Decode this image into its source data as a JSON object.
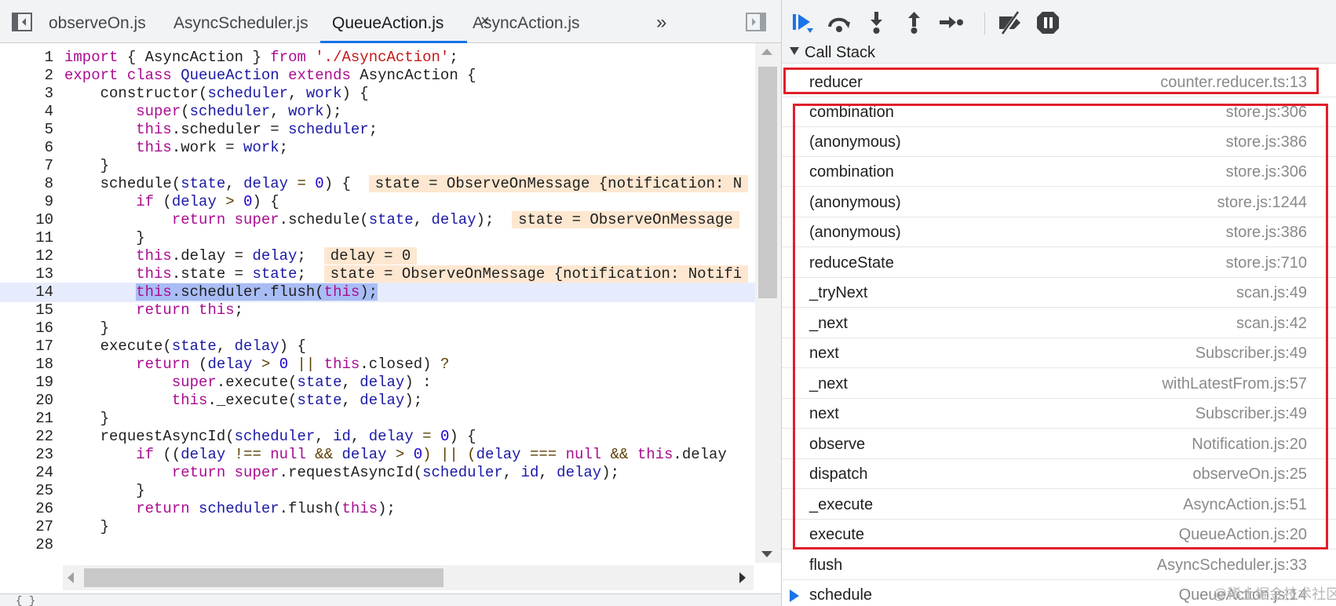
{
  "editor": {
    "tabs": [
      {
        "label": "observeOn.js"
      },
      {
        "label": "AsyncScheduler.js"
      },
      {
        "label": "QueueAction.js",
        "active": true,
        "close": "×"
      },
      {
        "label": "AsyncAction.js"
      }
    ],
    "overflow_icon": "»",
    "format_icon": "{ }",
    "execution_line": 14
  },
  "code_lines": [
    {
      "n": "1"
    },
    {
      "n": "2"
    },
    {
      "n": "3"
    },
    {
      "n": "4"
    },
    {
      "n": "5"
    },
    {
      "n": "6"
    },
    {
      "n": "7"
    },
    {
      "n": "8"
    },
    {
      "n": "9"
    },
    {
      "n": "10"
    },
    {
      "n": "11"
    },
    {
      "n": "12"
    },
    {
      "n": "13"
    },
    {
      "n": "14"
    },
    {
      "n": "15"
    },
    {
      "n": "16"
    },
    {
      "n": "17"
    },
    {
      "n": "18"
    },
    {
      "n": "19"
    },
    {
      "n": "20"
    },
    {
      "n": "21"
    },
    {
      "n": "22"
    },
    {
      "n": "23"
    },
    {
      "n": "24"
    },
    {
      "n": "25"
    },
    {
      "n": "26"
    },
    {
      "n": "27"
    },
    {
      "n": "28"
    }
  ],
  "code_text": {
    "l1": {
      "a": "import",
      "b": " { AsyncAction } ",
      "c": "from",
      "d": " ",
      "e": "'./AsyncAction'",
      "f": ";"
    },
    "l2": {
      "a": "export",
      "b": " ",
      "c": "class",
      "d": " ",
      "e": "QueueAction",
      "f": " ",
      "g": "extends",
      "h": " AsyncAction {"
    },
    "l3": {
      "a": "    constructor(",
      "b": "scheduler",
      "c": ", ",
      "d": "work",
      "e": ") {"
    },
    "l4": {
      "a": "        ",
      "b": "super",
      "c": "(",
      "d": "scheduler",
      "e": ", ",
      "f": "work",
      "g": ");"
    },
    "l5": {
      "a": "        ",
      "b": "this",
      "c": ".scheduler = ",
      "d": "scheduler",
      "e": ";"
    },
    "l6": {
      "a": "        ",
      "b": "this",
      "c": ".work = ",
      "d": "work",
      "e": ";"
    },
    "l7": {
      "a": "    }"
    },
    "l8": {
      "a": "    schedule(",
      "b": "state",
      "c": ", ",
      "d": "delay",
      "e": " = ",
      "f": "0",
      "g": ") {  ",
      "h": "state = ObserveOnMessage {notification: N"
    },
    "l9": {
      "a": "        ",
      "b": "if",
      "c": " (",
      "d": "delay",
      "e": " > ",
      "f": "0",
      "g": ") {"
    },
    "l10": {
      "a": "            ",
      "b": "return",
      "c": " ",
      "d": "super",
      "e": ".schedule(",
      "f": "state",
      "g": ", ",
      "h": "delay",
      "i": ");  ",
      "j": "state = ObserveOnMessage"
    },
    "l11": {
      "a": "        }"
    },
    "l12": {
      "a": "        ",
      "b": "this",
      "c": ".delay = ",
      "d": "delay",
      "e": ";  ",
      "f": "delay = 0"
    },
    "l13": {
      "a": "        ",
      "b": "this",
      "c": ".state = ",
      "d": "state",
      "e": ";  ",
      "f": "state = ObserveOnMessage {notification: Notifi"
    },
    "l14": {
      "a": "        ",
      "b": "this",
      "c": ".scheduler.flush(",
      "d": "this",
      "e": ");"
    },
    "l15": {
      "a": "        ",
      "b": "return",
      "c": " ",
      "d": "this",
      "e": ";"
    },
    "l16": {
      "a": "    }"
    },
    "l17": {
      "a": "    execute(",
      "b": "state",
      "c": ", ",
      "d": "delay",
      "e": ") {"
    },
    "l18": {
      "a": "        ",
      "b": "return",
      "c": " (",
      "d": "delay",
      "e": " > ",
      "f": "0",
      "g": " || ",
      "h": "this",
      "i": ".closed) ",
      "j": "?"
    },
    "l19": {
      "a": "            ",
      "b": "super",
      "c": ".execute(",
      "d": "state",
      "e": ", ",
      "f": "delay",
      "g": ") :"
    },
    "l20": {
      "a": "            ",
      "b": "this",
      "c": "._execute(",
      "d": "state",
      "e": ", ",
      "f": "delay",
      "g": ");"
    },
    "l21": {
      "a": "    }"
    },
    "l22": {
      "a": "    requestAsyncId(",
      "b": "scheduler",
      "c": ", ",
      "d": "id",
      "e": ", ",
      "f": "delay",
      "g": " = ",
      "h": "0",
      "i": ") {"
    },
    "l23": {
      "a": "        ",
      "b": "if",
      "c": " ((",
      "d": "delay",
      "e": " !== ",
      "f": "null",
      "g": " && ",
      "h": "delay",
      "i": " > ",
      "j": "0",
      "k": ") || (",
      "l": "delay",
      "m": " === ",
      "n": "null",
      "o": " && ",
      "p": "this",
      "q": ".delay"
    },
    "l24": {
      "a": "            ",
      "b": "return",
      "c": " ",
      "d": "super",
      "e": ".requestAsyncId(",
      "f": "scheduler",
      "g": ", ",
      "h": "id",
      "i": ", ",
      "j": "delay",
      "k": ");"
    },
    "l25": {
      "a": "        }"
    },
    "l26": {
      "a": "        ",
      "b": "return",
      "c": " ",
      "d": "scheduler",
      "e": ".flush(",
      "f": "this",
      "g": ");"
    },
    "l27": {
      "a": "    }"
    },
    "l28": {
      "a": ""
    }
  },
  "debugger": {
    "call_stack_title": "Call Stack",
    "buttons": [
      "resume-icon",
      "step-over-icon",
      "step-into-icon",
      "step-out-icon",
      "step-icon",
      "deactivate-breakpoints-icon",
      "pause-on-exceptions-icon"
    ],
    "frames": [
      {
        "fn": "reducer",
        "loc": "counter.reducer.ts:13"
      },
      {
        "fn": "combination",
        "loc": "store.js:306"
      },
      {
        "fn": "(anonymous)",
        "loc": "store.js:386"
      },
      {
        "fn": "combination",
        "loc": "store.js:306"
      },
      {
        "fn": "(anonymous)",
        "loc": "store.js:1244"
      },
      {
        "fn": "(anonymous)",
        "loc": "store.js:386"
      },
      {
        "fn": "reduceState",
        "loc": "store.js:710"
      },
      {
        "fn": "_tryNext",
        "loc": "scan.js:49"
      },
      {
        "fn": "_next",
        "loc": "scan.js:42"
      },
      {
        "fn": "next",
        "loc": "Subscriber.js:49"
      },
      {
        "fn": "_next",
        "loc": "withLatestFrom.js:57"
      },
      {
        "fn": "next",
        "loc": "Subscriber.js:49"
      },
      {
        "fn": "observe",
        "loc": "Notification.js:20"
      },
      {
        "fn": "dispatch",
        "loc": "observeOn.js:25"
      },
      {
        "fn": "_execute",
        "loc": "AsyncAction.js:51"
      },
      {
        "fn": "execute",
        "loc": "QueueAction.js:20"
      },
      {
        "fn": "flush",
        "loc": "AsyncScheduler.js:33"
      },
      {
        "fn": "schedule",
        "loc": "QueueAction.js:14",
        "current": true
      }
    ],
    "highlight_color": "#e01f2a"
  },
  "watermark": "@稀土掘金技术社区",
  "colors": {
    "accent": "#1a73e8",
    "keyword": "#aa0d91",
    "string": "#c41a16",
    "number": "#1c00cf",
    "inline_value_bg": "#fde7d1",
    "exec_line_bg": "#e7ecfc"
  }
}
